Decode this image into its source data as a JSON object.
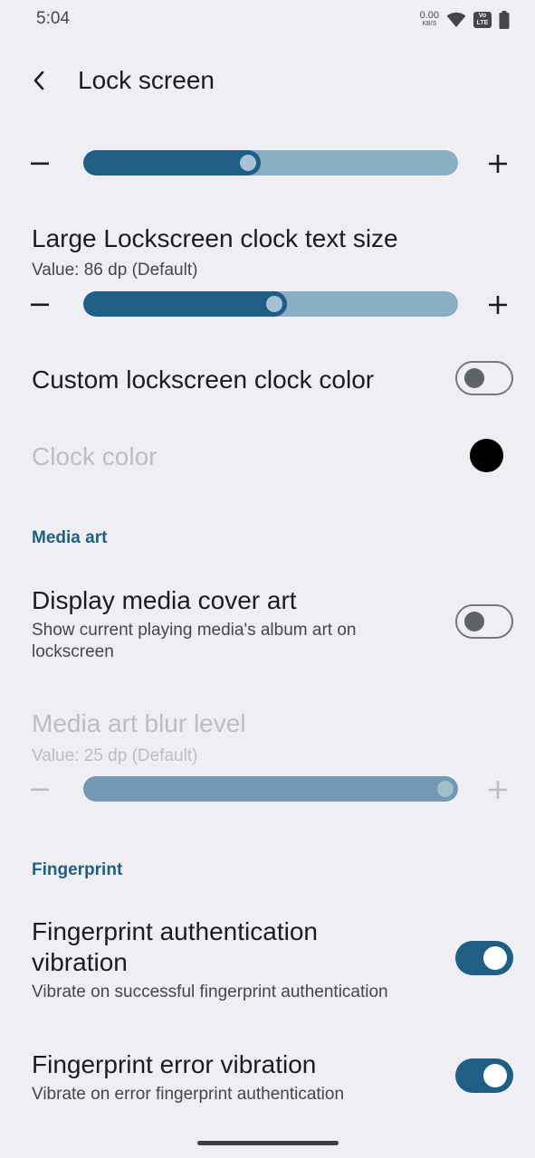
{
  "status_bar": {
    "time": "5:04",
    "net_speed": "0.00",
    "net_unit": "KB/S",
    "volte_top": "Vo",
    "volte_bottom": "LTE"
  },
  "header": {
    "title": "Lock screen"
  },
  "top_slider": {
    "level": 0.44
  },
  "clock_size": {
    "title": "Large Lockscreen clock text size",
    "value": "Value: 86 dp (Default)",
    "level": 0.51
  },
  "custom_clock_color": {
    "title": "Custom lockscreen clock color",
    "enabled": false
  },
  "clock_color": {
    "title": "Clock color",
    "color": "#000000"
  },
  "media_art_section": {
    "label": "Media art"
  },
  "display_media_cover": {
    "title": "Display media cover art",
    "subtitle": "Show current playing media's album art on lockscreen",
    "enabled": false
  },
  "media_blur": {
    "title": "Media art blur level",
    "value": "Value: 25 dp (Default)",
    "level": 1.0
  },
  "fingerprint_section": {
    "label": "Fingerprint"
  },
  "fp_auth_vibration": {
    "title": "Fingerprint authentication vibration",
    "subtitle": "Vibrate on successful fingerprint authentication",
    "enabled": true
  },
  "fp_error_vibration": {
    "title": "Fingerprint error vibration",
    "subtitle": "Vibrate on error fingerprint authentication",
    "enabled": true
  },
  "colors": {
    "accent": "#1f5f86",
    "track": "#8aaec4",
    "background": "#efeff3"
  }
}
